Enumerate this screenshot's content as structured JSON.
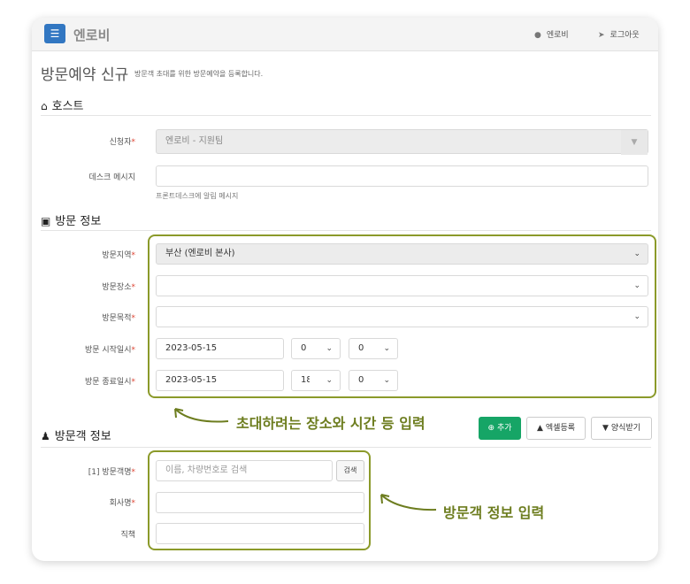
{
  "header": {
    "brand": "엔로비",
    "user": "엔로비",
    "logout": "로그아웃"
  },
  "page": {
    "title": "방문예약 신규",
    "subtitle": "방문객 초대를 위한 방문예약을 등록합니다."
  },
  "host": {
    "section_title": "호스트",
    "applicant_label": "신청자",
    "applicant_value": "엔로비 - 지원팀",
    "desk_label": "데스크 메시지",
    "desk_value": "",
    "desk_help": "프론트데스크에 알림 메시지"
  },
  "visit": {
    "section_title": "방문 정보",
    "region_label": "방문지역",
    "region_value": "부산 (엔로비 본사)",
    "place_label": "방문장소",
    "place_value": "",
    "purpose_label": "방문목적",
    "purpose_value": "",
    "start_label": "방문 시작일시",
    "start_date": "2023-05-15",
    "start_hour": "0",
    "start_min": "0",
    "end_label": "방문 종료일시",
    "end_date": "2023-05-15",
    "end_hour": "18",
    "end_min": "0"
  },
  "visitor": {
    "section_title": "방문객 정보",
    "add_button": "추가",
    "excel_button": "엑셀등록",
    "form_button": "양식받기",
    "name_label": "[1] 방문객명",
    "name_placeholder": "이름, 차량번호로 검색",
    "search_button": "검색",
    "company_label": "회사명",
    "company_value": "",
    "title_label": "직책",
    "title_value": ""
  },
  "annotations": {
    "visit_note": "초대하려는 장소와 시간 등 입력",
    "visitor_note": "방문객 정보 입력"
  },
  "required_mark": "*",
  "colors": {
    "highlight": "#8b9a2a",
    "annotation_text": "#6d7d1f",
    "menu_button": "#3277c2",
    "add_button": "#16a566"
  }
}
